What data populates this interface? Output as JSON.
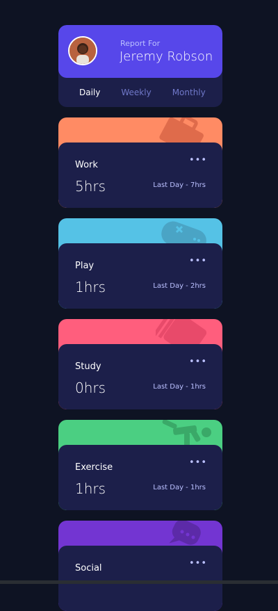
{
  "profile": {
    "report_for": "Report For",
    "name": "Jeremy Robson",
    "tabs": [
      {
        "label": "Daily",
        "active": true
      },
      {
        "label": "Weekly",
        "active": false
      },
      {
        "label": "Monthly",
        "active": false
      }
    ]
  },
  "activities": [
    {
      "title": "Work",
      "hours": "5hrs",
      "last": "Last Day - 7hrs",
      "color": "#ff8b64",
      "icon": "briefcase-icon"
    },
    {
      "title": "Play",
      "hours": "1hrs",
      "last": "Last Day - 2hrs",
      "color": "#55c2e6",
      "icon": "gamepad-icon"
    },
    {
      "title": "Study",
      "hours": "0hrs",
      "last": "Last Day - 1hrs",
      "color": "#ff5e7d",
      "icon": "book-icon"
    },
    {
      "title": "Exercise",
      "hours": "1hrs",
      "last": "Last Day - 1hrs",
      "color": "#4bcf82",
      "icon": "running-icon"
    },
    {
      "title": "Social",
      "hours": "",
      "last": "",
      "color": "#7335d2",
      "icon": "chat-icon"
    }
  ],
  "ellipsis": "•••"
}
